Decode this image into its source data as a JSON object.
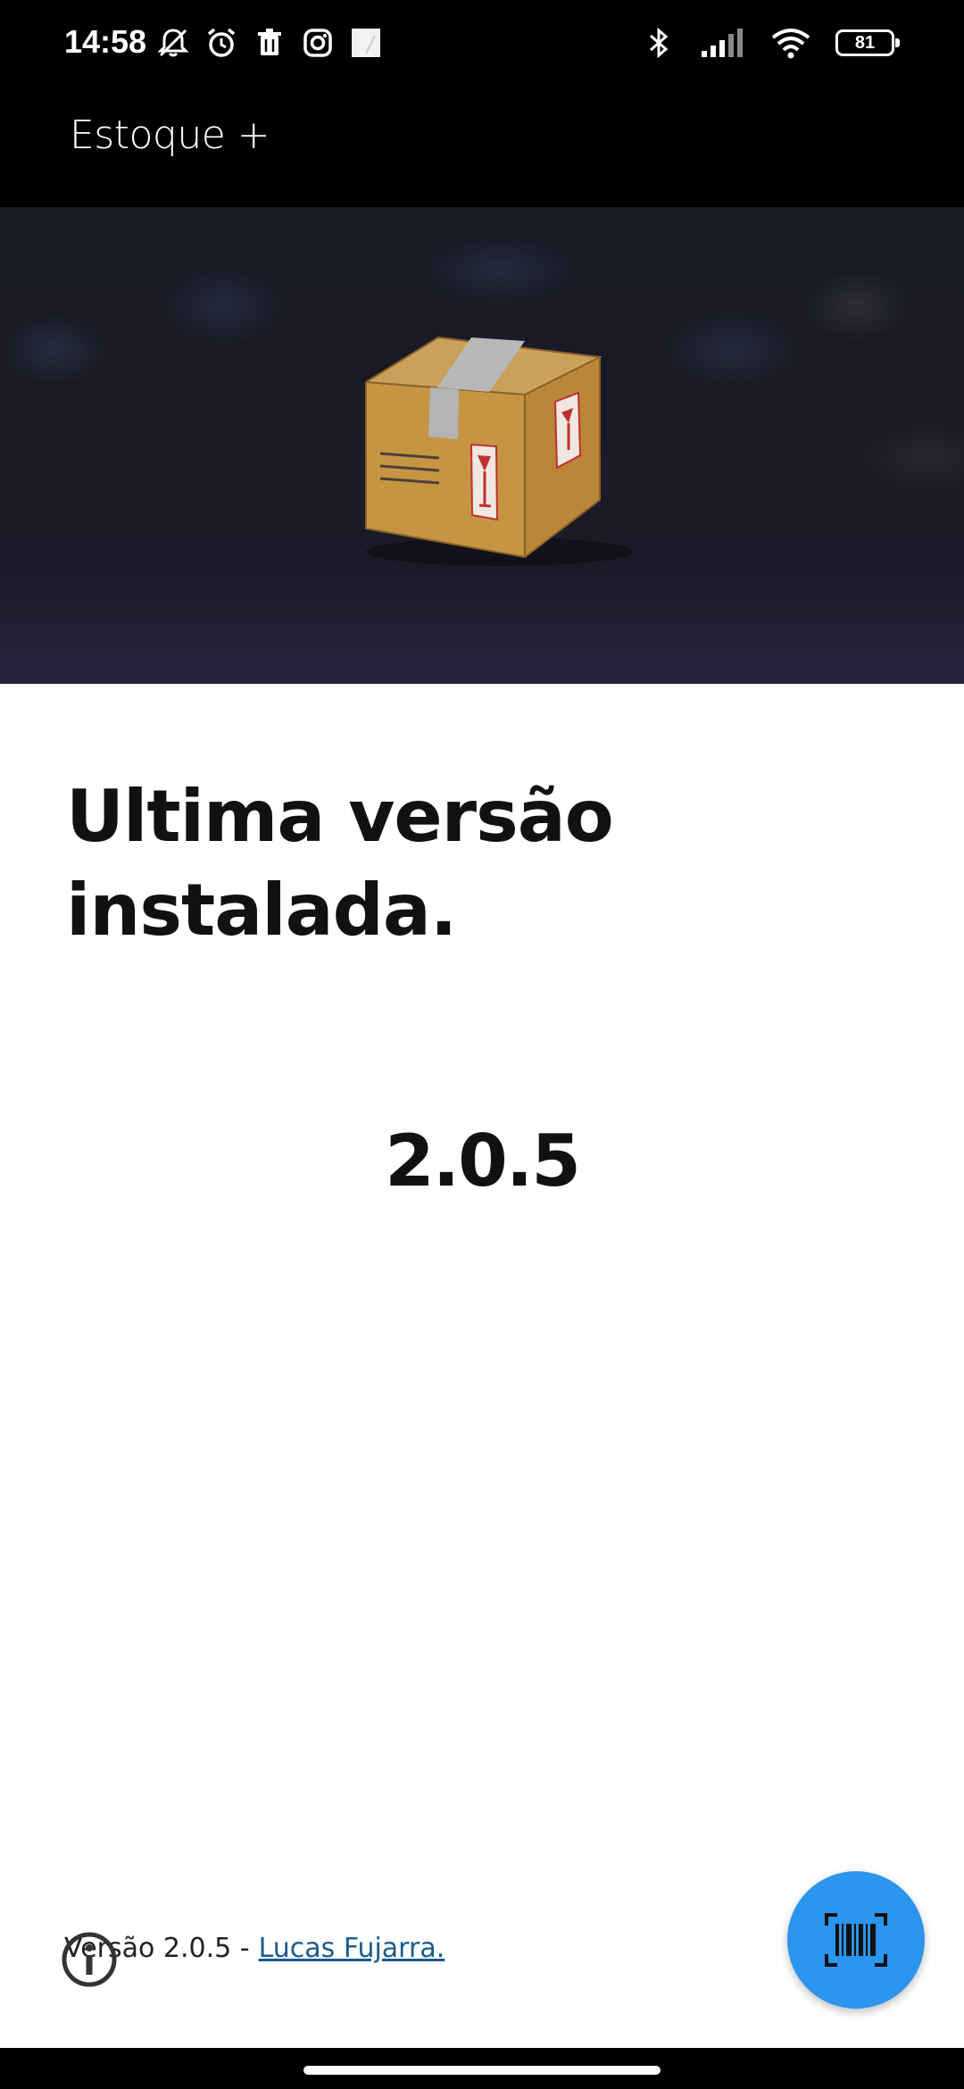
{
  "status_bar": {
    "time": "14:58",
    "battery_level": "81",
    "left_icons": [
      "muted-notifications-icon",
      "alarm-icon",
      "trash-icon",
      "instagram-icon",
      "image-icon"
    ],
    "right_icons": [
      "bluetooth-icon",
      "signal-icon",
      "wifi-icon",
      "battery-icon"
    ]
  },
  "app_bar": {
    "title": "Estoque +"
  },
  "hero": {
    "image": "cardboard-box-icon",
    "background_color": "#1a1a24"
  },
  "main": {
    "heading": "Ultima versão instalada.",
    "version": "2.0.5"
  },
  "footer": {
    "version_text": "Versão 2.0.5 -",
    "author_link": "Lucas Fujarra.",
    "link_color": "#1a5c8a"
  },
  "fab": {
    "icon": "barcode-scan-icon",
    "color": "#2b94ec"
  }
}
